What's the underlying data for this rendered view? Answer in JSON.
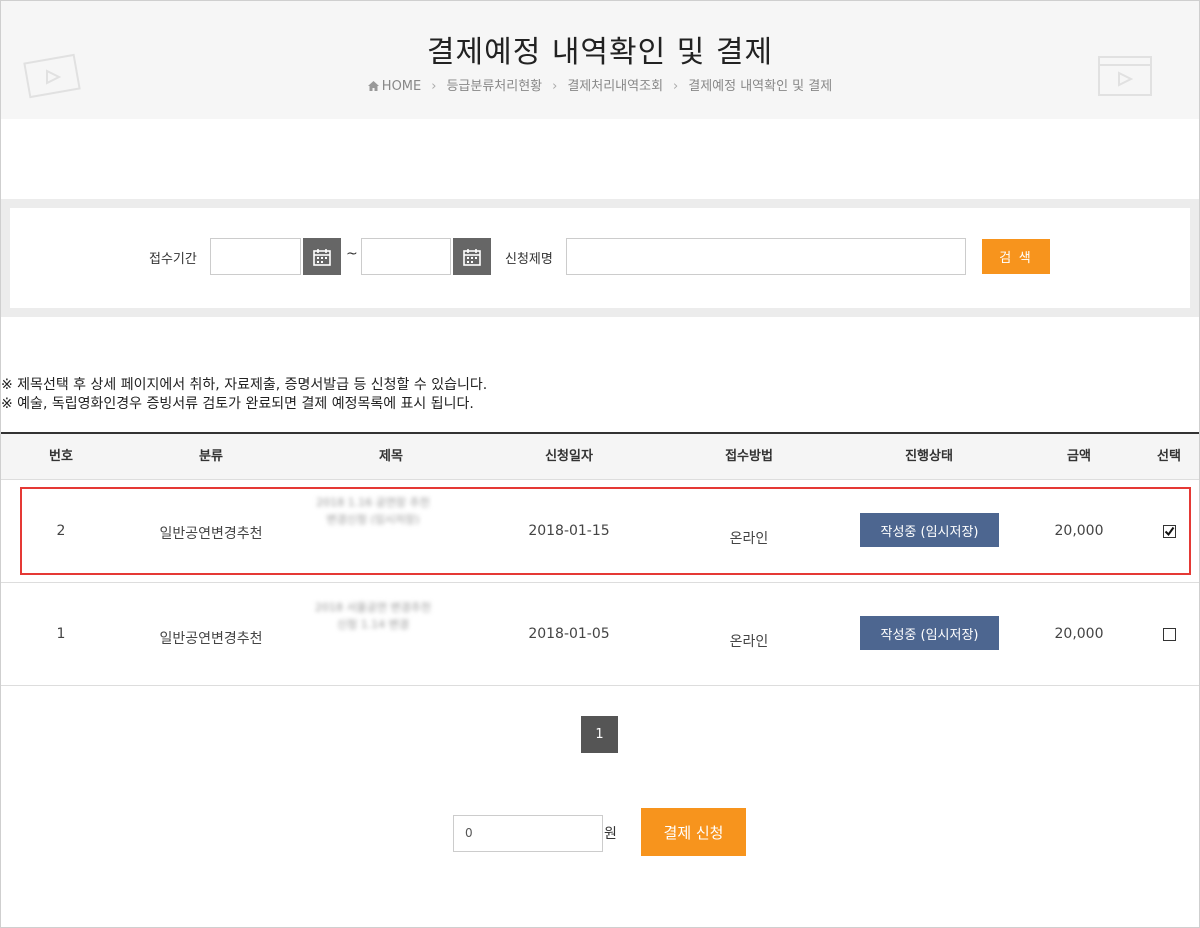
{
  "header": {
    "title": "결제예정 내역확인 및 결제",
    "breadcrumb": [
      "HOME",
      "등급분류처리현황",
      "결제처리내역조회",
      "결제예정 내역확인 및 결제"
    ]
  },
  "search": {
    "period_label": "접수기간",
    "start_date": "",
    "end_date": "",
    "tilde": "~",
    "title_label": "신청제명",
    "title_value": "",
    "button_label": "검 색"
  },
  "notices": [
    "※ 제목선택 후 상세 페이지에서 취하, 자료제출, 증명서발급 등 신청할 수 있습니다.",
    "※ 예술, 독립영화인경우 증빙서류 검토가 완료되면 결제 예정목록에 표시 됩니다."
  ],
  "table": {
    "headers": [
      "번호",
      "분류",
      "제목",
      "신청일자",
      "접수방법",
      "진행상태",
      "금액",
      "선택"
    ],
    "rows": [
      {
        "no": "2",
        "category": "일반공연변경추천",
        "title": "2018 1.16 공연장 추천 변경신청 (임시저장)",
        "date": "2018-01-15",
        "method": "온라인",
        "status": "작성중 (임시저장)",
        "amount": "20,000",
        "checked": true
      },
      {
        "no": "1",
        "category": "일반공연변경추천",
        "title": "2018 서울공연 변경추천 신청 1.14 변경",
        "date": "2018-01-05",
        "method": "온라인",
        "status": "작성중 (임시저장)",
        "amount": "20,000",
        "checked": false
      }
    ]
  },
  "pagination": {
    "current": "1"
  },
  "payment": {
    "amount": "0",
    "unit": "원",
    "button_label": "결제 신청"
  },
  "colors": {
    "accent": "#f7941d",
    "status_button": "#4d6690",
    "highlight": "#e53935"
  }
}
